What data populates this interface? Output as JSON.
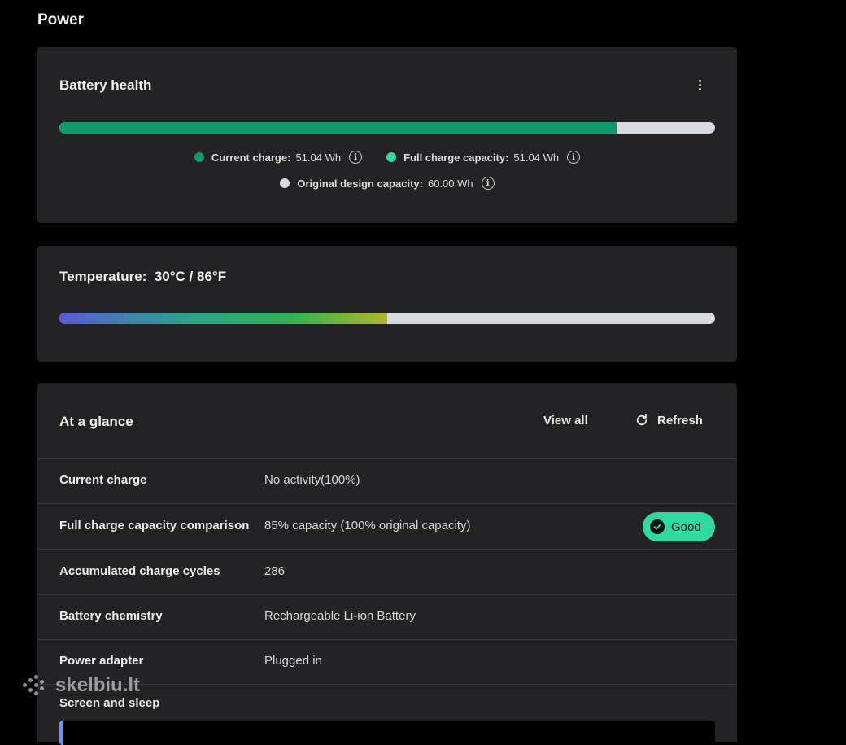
{
  "page": {
    "title": "Power"
  },
  "battery_health": {
    "title": "Battery health",
    "menu_icon": "more-vertical-icon",
    "bar_fill_fraction": 0.85,
    "legend": [
      {
        "label": "Current charge:",
        "value": "51.04 Wh",
        "color": "#0f9a6a"
      },
      {
        "label": "Full charge capacity:",
        "value": "51.04 Wh",
        "color": "#2fd9a0"
      },
      {
        "label": "Original design capacity:",
        "value": "60.00 Wh",
        "color": "#d6dbe3"
      }
    ],
    "info_glyph": "i"
  },
  "temperature": {
    "label": "Temperature:",
    "value": "30°C / 86°F",
    "bar_fill_fraction": 0.5
  },
  "at_a_glance": {
    "title": "At a glance",
    "view_all": "View all",
    "refresh": "Refresh",
    "rows": [
      {
        "key": "Current charge",
        "value": "No activity(100%)"
      },
      {
        "key": "Full charge capacity comparison",
        "value": "85% capacity (100% original capacity)",
        "badge": "Good"
      },
      {
        "key": "Accumulated charge cycles",
        "value": "286"
      },
      {
        "key": "Battery chemistry",
        "value": "Rechargeable Li-ion Battery"
      },
      {
        "key": "Power adapter",
        "value": "Plugged in"
      }
    ],
    "screen_and_sleep": "Screen and sleep"
  },
  "watermark": {
    "text": "skelbiu.lt"
  },
  "colors": {
    "accent_green": "#0f9a6a",
    "badge_green": "#2fd9a0",
    "card_bg": "#232326"
  }
}
